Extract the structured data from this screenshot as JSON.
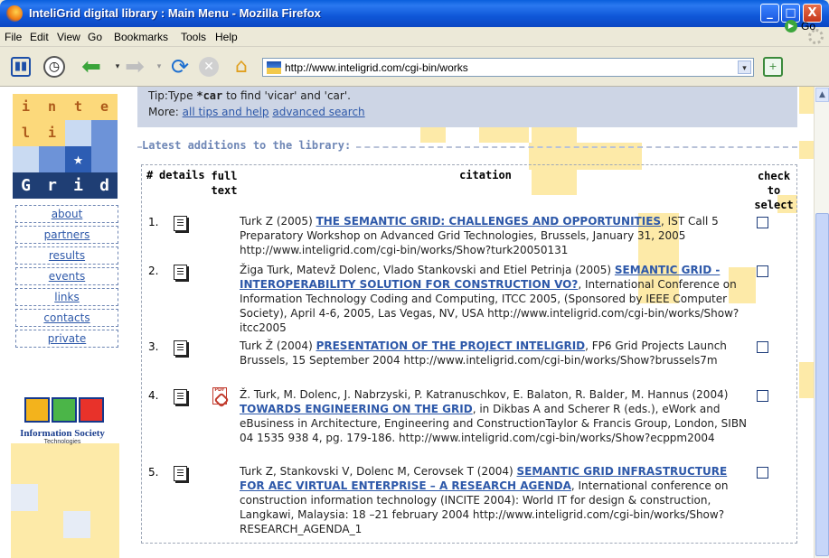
{
  "window": {
    "title": "InteliGrid digital library : Main Menu - Mozilla Firefox",
    "controls": {
      "minimize": "_",
      "maximize": "□",
      "close": "X"
    }
  },
  "menubar": {
    "items": [
      "File",
      "Edit",
      "View",
      "Go",
      "Bookmarks",
      "Tools",
      "Help"
    ]
  },
  "toolbar": {
    "url": "http://www.inteligrid.com/cgi-bin/works",
    "go_label": "Go",
    "icons": [
      "bookmarks-panel-icon",
      "history-icon",
      "back-icon",
      "forward-icon",
      "reload-icon",
      "stop-icon",
      "home-icon"
    ]
  },
  "sidebar": {
    "logo_letters": [
      "i",
      "n",
      "t",
      "e",
      "l",
      "i",
      "★",
      "G",
      "r",
      "i",
      "d"
    ],
    "links": [
      "about",
      "partners",
      "results",
      "events",
      "links",
      "contacts",
      "private"
    ],
    "sponsor": {
      "name": "Information Society",
      "sub": "Technologies"
    }
  },
  "tips": {
    "prefix": "Tip:",
    "text_before": "Type ",
    "code": "*car",
    "text_after": " to find 'vicar' and 'car'.",
    "more_label": "More:",
    "links": [
      "all tips and help",
      "advanced search"
    ]
  },
  "section": {
    "title": "Latest additions to the library:"
  },
  "table": {
    "headers": {
      "num": "#",
      "details": "details",
      "fulltext": "full text",
      "citation": "citation",
      "select": "check to select"
    },
    "rows": [
      {
        "num": "1.",
        "pre": "Turk Z (2005) ",
        "title": "THE SEMANTIC GRID: CHALLENGES AND OPPORTUNITIES",
        "post": ", IST Call 5 Preparatory Workshop on Advanced Grid Technologies, Brussels, January 31, 2005 http://www.inteligrid.com/cgi-bin/works/Show?turk20050131",
        "has_pdf": false
      },
      {
        "num": "2.",
        "pre": "Žiga Turk, Matevž Dolenc, Vlado Stankovski and Etiel Petrinja (2005) ",
        "title": "SEMANTIC GRID - INTEROPERABILITY SOLUTION FOR CONSTRUCTION VO?",
        "post": ", International Conference on Information Technology Coding and Computing, ITCC 2005, (Sponsored by IEEE Computer Society), April 4-6, 2005, Las Vegas, NV, USA http://www.inteligrid.com/cgi-bin/works/Show?itcc2005",
        "has_pdf": false
      },
      {
        "num": "3.",
        "pre": "Turk Ž (2004) ",
        "title": "PRESENTATION OF THE PROJECT INTELIGRID",
        "post": ", FP6 Grid Projects Launch Brussels, 15 September 2004 http://www.inteligrid.com/cgi-bin/works/Show?brussels7m",
        "has_pdf": false
      },
      {
        "num": "4.",
        "pre": "Ž. Turk, M. Dolenc, J. Nabrzyski, P. Katranuschkov, E. Balaton, R. Balder, M. Hannus (2004) ",
        "title": "TOWARDS ENGINEERING ON THE GRID",
        "post": ", in Dikbas A and Scherer R (eds.), eWork and eBusiness in Architecture, Engineering and ConstructionTaylor & Francis Group, London, SIBN 04 1535 938 4, pg. 179-186. http://www.inteligrid.com/cgi-bin/works/Show?ecppm2004",
        "has_pdf": true
      },
      {
        "num": "5.",
        "pre": "Turk Z, Stankovski V, Dolenc M, Cerovsek T (2004) ",
        "title": "SEMANTIC GRID INFRASTRUCTURE FOR AEC VIRTUAL ENTERPRISE – A RESEARCH AGENDA",
        "post": ", International conference on construction information technology (INCITE 2004): World IT for design & construction, Langkawi, Malaysia: 18 –21 february 2004 http://www.inteligrid.com/cgi-bin/works/Show?RESEARCH_AGENDA_1",
        "has_pdf": false
      }
    ]
  }
}
